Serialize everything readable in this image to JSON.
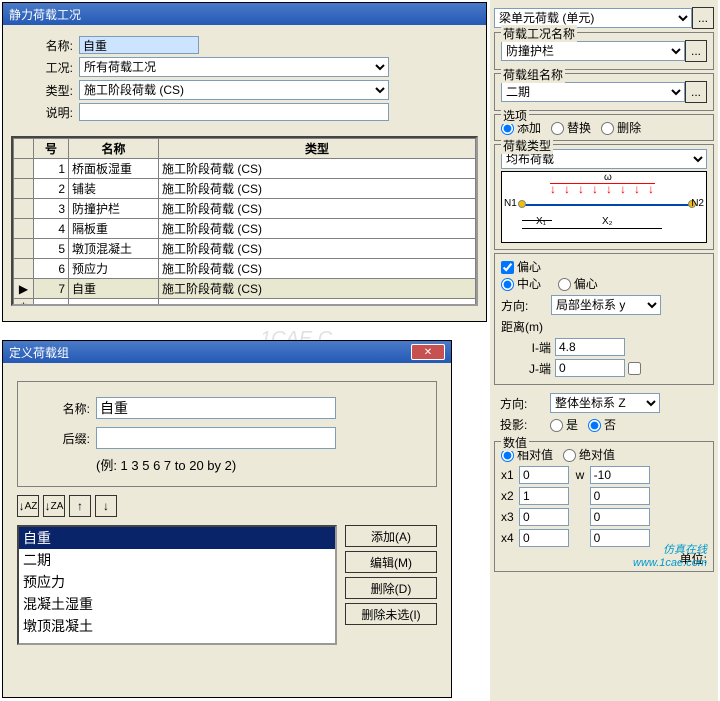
{
  "win1": {
    "title": "静力荷载工况",
    "labels": {
      "name": "名称:",
      "case": "工况:",
      "type": "类型:",
      "desc": "说明:"
    },
    "fields": {
      "name": "自重",
      "case": "所有荷载工况",
      "type": "施工阶段荷载 (CS)",
      "desc": ""
    },
    "table": {
      "cols": [
        "号",
        "名称",
        "类型"
      ],
      "rows": [
        [
          "1",
          "桥面板湿重",
          "施工阶段荷载 (CS)"
        ],
        [
          "2",
          "铺装",
          "施工阶段荷载 (CS)"
        ],
        [
          "3",
          "防撞护栏",
          "施工阶段荷载 (CS)"
        ],
        [
          "4",
          "隔板重",
          "施工阶段荷载 (CS)"
        ],
        [
          "5",
          "墩顶混凝土",
          "施工阶段荷载 (CS)"
        ],
        [
          "6",
          "预应力",
          "施工阶段荷载 (CS)"
        ],
        [
          "7",
          "自重",
          "施工阶段荷载 (CS)"
        ]
      ],
      "selMarker": "▶",
      "newMarker": "*"
    }
  },
  "win2": {
    "title": "定义荷载组",
    "labels": {
      "name": "名称:",
      "suffix": "后缀:",
      "example": "(例: 1 3 5 6 7 to 20 by 2)"
    },
    "fields": {
      "name": "自重",
      "suffix": ""
    },
    "sortbtns": [
      "↓A↓Z",
      "↓Z↓A",
      "↑",
      "↓"
    ],
    "buttons": {
      "add": "添加(A)",
      "edit": "编辑(M)",
      "del": "删除(D)",
      "delunsel": "删除未选(I)"
    },
    "list": [
      "自重",
      "二期",
      "预应力",
      "混凝土湿重",
      "墩顶混凝土"
    ]
  },
  "right": {
    "top": "梁单元荷载 (单元)",
    "p1": {
      "title": "荷载工况名称",
      "val": "防撞护栏"
    },
    "p2": {
      "title": "荷载组名称",
      "val": "二期"
    },
    "opts": {
      "title": "选项",
      "add": "添加",
      "rep": "替换",
      "del": "删除"
    },
    "loadtype": {
      "title": "荷载类型",
      "val": "均布荷载"
    },
    "diagram": {
      "omega": "ω",
      "n1": "N1",
      "n2": "N2",
      "x1": "X₁",
      "x2": "X₂"
    },
    "ecc": {
      "chk": "偏心",
      "center": "中心",
      "offset": "偏心",
      "dir": "方向:",
      "dirval": "局部坐标系 y",
      "dist": "距离(m)",
      "iend": "I-端",
      "jend": "J-端",
      "ival": "4.8",
      "jval": "0"
    },
    "dir2": {
      "dir": "方向:",
      "val": "整体坐标系 Z",
      "proj": "投影:",
      "yes": "是",
      "no": "否"
    },
    "values": {
      "title": "数值",
      "rel": "相对值",
      "abs": "绝对值",
      "x1": "x1",
      "x2": "x2",
      "x3": "x3",
      "x4": "x4",
      "w": "w",
      "x1v": "0",
      "x2v": "1",
      "x3v": "0",
      "x4v": "0",
      "wv": "-10",
      "wv2": "0",
      "wv3": "0",
      "wv4": "0",
      "unit": "单位:"
    }
  },
  "watermark": "仿真在线\nwww.1cae.com",
  "wm_short": "1CAE.C"
}
